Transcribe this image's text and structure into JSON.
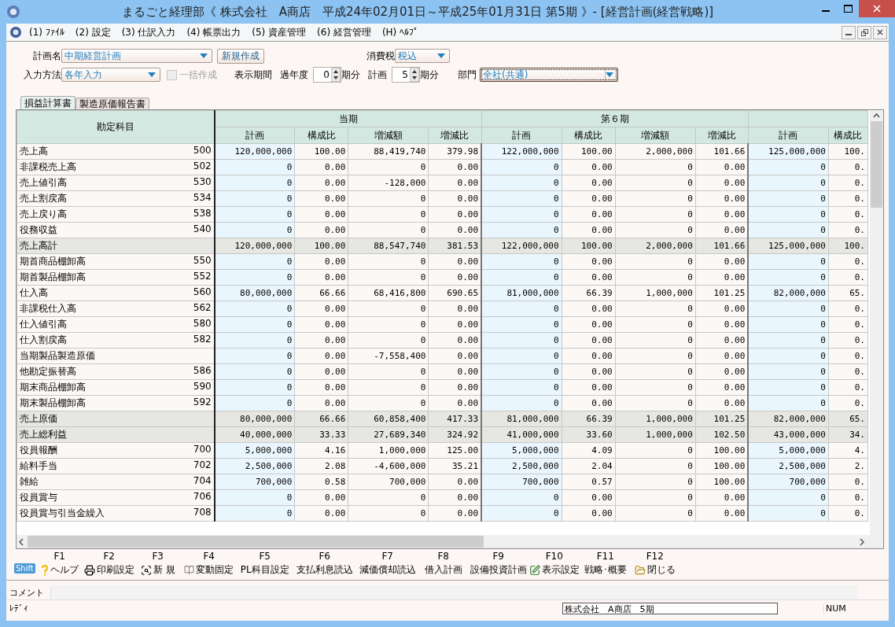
{
  "window": {
    "title": "まるごと経理部《 株式会社　A商店　平成24年02月01日～平成25年01月31日 第5期 》- [経営計画(経営戦略)]"
  },
  "menu": [
    {
      "label": "(1) ﾌｧｲﾙ"
    },
    {
      "label": "(2) 設定"
    },
    {
      "label": "(3) 仕訳入力"
    },
    {
      "label": "(4) 帳票出力"
    },
    {
      "label": "(5) 資産管理"
    },
    {
      "label": "(6) 経営管理"
    },
    {
      "label": "(H) ﾍﾙﾌﾟ"
    }
  ],
  "form": {
    "plan_name": {
      "label": "計画名",
      "value": "中期経営計画"
    },
    "new_button": "新規作成",
    "tax": {
      "label": "消費税",
      "value": "税込"
    },
    "input_method": {
      "label": "入力方法",
      "value": "各年入力"
    },
    "bulk_create": {
      "label": "一括作成",
      "checked": false,
      "disabled": true
    },
    "period_label": "表示期間",
    "past": {
      "label": "過年度",
      "value": "0",
      "unit": "期分"
    },
    "plan": {
      "label": "計画",
      "value": "5",
      "unit": "期分"
    },
    "department": {
      "label": "部門",
      "value": "全社(共通)",
      "focused": true
    }
  },
  "tabs": [
    {
      "label": "損益計算書",
      "selected": true
    },
    {
      "label": "製造原価報告書",
      "selected": false
    }
  ],
  "table": {
    "account_header": "勘定科目",
    "groups": [
      {
        "label": "当期",
        "columns": [
          "計画",
          "構成比",
          "増減額",
          "増減比"
        ]
      },
      {
        "label": "第６期",
        "columns": [
          "計画",
          "構成比",
          "増減額",
          "増減比"
        ]
      },
      {
        "columns": [
          "計画",
          "構成比"
        ]
      }
    ],
    "rows": [
      {
        "name": "売上高",
        "code": "500",
        "kind": "item",
        "values": [
          "120,000,000",
          "100.00",
          "88,419,740",
          "379.98",
          "122,000,000",
          "100.00",
          "2,000,000",
          "101.66",
          "125,000,000",
          "100."
        ]
      },
      {
        "name": "非課税売上高",
        "code": "502",
        "kind": "item",
        "values": [
          "0",
          "0.00",
          "0",
          "0.00",
          "0",
          "0.00",
          "0",
          "0.00",
          "0",
          "0."
        ]
      },
      {
        "name": "売上値引高",
        "code": "530",
        "kind": "item",
        "values": [
          "0",
          "0.00",
          "-128,000",
          "0.00",
          "0",
          "0.00",
          "0",
          "0.00",
          "0",
          "0."
        ]
      },
      {
        "name": "売上割戻高",
        "code": "534",
        "kind": "item",
        "values": [
          "0",
          "0.00",
          "0",
          "0.00",
          "0",
          "0.00",
          "0",
          "0.00",
          "0",
          "0."
        ]
      },
      {
        "name": "売上戻り高",
        "code": "538",
        "kind": "item",
        "values": [
          "0",
          "0.00",
          "0",
          "0.00",
          "0",
          "0.00",
          "0",
          "0.00",
          "0",
          "0."
        ]
      },
      {
        "name": "役務収益",
        "code": "540",
        "kind": "item",
        "values": [
          "0",
          "0.00",
          "0",
          "0.00",
          "0",
          "0.00",
          "0",
          "0.00",
          "0",
          "0."
        ]
      },
      {
        "name": "売上高計",
        "kind": "total",
        "values": [
          "120,000,000",
          "100.00",
          "88,547,740",
          "381.53",
          "122,000,000",
          "100.00",
          "2,000,000",
          "101.66",
          "125,000,000",
          "100."
        ]
      },
      {
        "name": "期首商品棚卸高",
        "code": "550",
        "kind": "item",
        "values": [
          "0",
          "0.00",
          "0",
          "0.00",
          "0",
          "0.00",
          "0",
          "0.00",
          "0",
          "0."
        ]
      },
      {
        "name": "期首製品棚卸高",
        "code": "552",
        "kind": "item",
        "values": [
          "0",
          "0.00",
          "0",
          "0.00",
          "0",
          "0.00",
          "0",
          "0.00",
          "0",
          "0."
        ]
      },
      {
        "name": "仕入高",
        "code": "560",
        "kind": "item",
        "values": [
          "80,000,000",
          "66.66",
          "68,416,800",
          "690.65",
          "81,000,000",
          "66.39",
          "1,000,000",
          "101.25",
          "82,000,000",
          "65."
        ]
      },
      {
        "name": "非課税仕入高",
        "code": "562",
        "kind": "item",
        "values": [
          "0",
          "0.00",
          "0",
          "0.00",
          "0",
          "0.00",
          "0",
          "0.00",
          "0",
          "0."
        ]
      },
      {
        "name": "仕入値引高",
        "code": "580",
        "kind": "item",
        "values": [
          "0",
          "0.00",
          "0",
          "0.00",
          "0",
          "0.00",
          "0",
          "0.00",
          "0",
          "0."
        ]
      },
      {
        "name": "仕入割戻高",
        "code": "582",
        "kind": "item",
        "values": [
          "0",
          "0.00",
          "0",
          "0.00",
          "0",
          "0.00",
          "0",
          "0.00",
          "0",
          "0."
        ]
      },
      {
        "name": "当期製品製造原価",
        "kind": "item",
        "values": [
          "0",
          "0.00",
          "-7,558,400",
          "0.00",
          "0",
          "0.00",
          "0",
          "0.00",
          "0",
          "0."
        ]
      },
      {
        "name": "他勘定振替高",
        "code": "586",
        "kind": "item",
        "values": [
          "0",
          "0.00",
          "0",
          "0.00",
          "0",
          "0.00",
          "0",
          "0.00",
          "0",
          "0."
        ]
      },
      {
        "name": "期末商品棚卸高",
        "code": "590",
        "kind": "item",
        "values": [
          "0",
          "0.00",
          "0",
          "0.00",
          "0",
          "0.00",
          "0",
          "0.00",
          "0",
          "0."
        ]
      },
      {
        "name": "期末製品棚卸高",
        "code": "592",
        "kind": "item",
        "values": [
          "0",
          "0.00",
          "0",
          "0.00",
          "0",
          "0.00",
          "0",
          "0.00",
          "0",
          "0."
        ]
      },
      {
        "name": "売上原価",
        "kind": "total",
        "values": [
          "80,000,000",
          "66.66",
          "60,858,400",
          "417.33",
          "81,000,000",
          "66.39",
          "1,000,000",
          "101.25",
          "82,000,000",
          "65."
        ]
      },
      {
        "name": "売上総利益",
        "kind": "total",
        "values": [
          "40,000,000",
          "33.33",
          "27,689,340",
          "324.92",
          "41,000,000",
          "33.60",
          "1,000,000",
          "102.50",
          "43,000,000",
          "34."
        ]
      },
      {
        "name": "役員報酬",
        "code": "700",
        "kind": "item",
        "values": [
          "5,000,000",
          "4.16",
          "1,000,000",
          "125.00",
          "5,000,000",
          "4.09",
          "0",
          "100.00",
          "5,000,000",
          "4."
        ]
      },
      {
        "name": "給料手当",
        "code": "702",
        "kind": "item",
        "values": [
          "2,500,000",
          "2.08",
          "-4,600,000",
          "35.21",
          "2,500,000",
          "2.04",
          "0",
          "100.00",
          "2,500,000",
          "2."
        ]
      },
      {
        "name": "雑給",
        "code": "704",
        "kind": "item",
        "values": [
          "700,000",
          "0.58",
          "700,000",
          "0.00",
          "700,000",
          "0.57",
          "0",
          "100.00",
          "700,000",
          "0."
        ]
      },
      {
        "name": "役員賞与",
        "code": "706",
        "kind": "item",
        "values": [
          "0",
          "0.00",
          "0",
          "0.00",
          "0",
          "0.00",
          "0",
          "0.00",
          "0",
          "0."
        ]
      },
      {
        "name": "役員賞与引当金繰入",
        "code": "708",
        "kind": "item",
        "values": [
          "0",
          "0.00",
          "0",
          "0.00",
          "0",
          "0.00",
          "0",
          "0.00",
          "0",
          "0."
        ]
      }
    ]
  },
  "function_keys": {
    "shift": "Shift",
    "keys": [
      {
        "key": "F1",
        "label": "ヘルプ"
      },
      {
        "key": "F2",
        "label": "印刷設定"
      },
      {
        "key": "F3",
        "label": "新 規"
      },
      {
        "key": "F4",
        "label": "変動固定"
      },
      {
        "key": "F5",
        "label": "PL科目設定"
      },
      {
        "key": "F6",
        "label": "支払利息読込"
      },
      {
        "key": "F7",
        "label": "減価償却読込"
      },
      {
        "key": "F8",
        "label": "借入計画"
      },
      {
        "key": "F9",
        "label": "設備投資計画"
      },
      {
        "key": "F10",
        "label": "表示設定"
      },
      {
        "key": "F11",
        "label": "戦略･概要"
      },
      {
        "key": "F12",
        "label": "閉じる"
      }
    ]
  },
  "comment": {
    "label": "コメント"
  },
  "status_bar": {
    "status": "ﾚﾃﾞｨ",
    "company": "株式会社　A商店　5期",
    "num": "NUM"
  }
}
